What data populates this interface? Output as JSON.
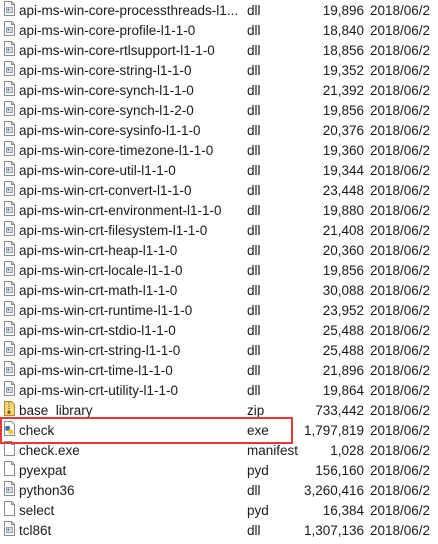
{
  "files": [
    {
      "name": "api-ms-win-core-processthreads-l1...",
      "type": "dll",
      "size": "19,896",
      "date": "2018/06/2",
      "icon": "dll-file-icon"
    },
    {
      "name": "api-ms-win-core-profile-l1-1-0",
      "type": "dll",
      "size": "18,840",
      "date": "2018/06/2",
      "icon": "dll-file-icon"
    },
    {
      "name": "api-ms-win-core-rtlsupport-l1-1-0",
      "type": "dll",
      "size": "18,856",
      "date": "2018/06/2",
      "icon": "dll-file-icon"
    },
    {
      "name": "api-ms-win-core-string-l1-1-0",
      "type": "dll",
      "size": "19,352",
      "date": "2018/06/2",
      "icon": "dll-file-icon"
    },
    {
      "name": "api-ms-win-core-synch-l1-1-0",
      "type": "dll",
      "size": "21,392",
      "date": "2018/06/2",
      "icon": "dll-file-icon"
    },
    {
      "name": "api-ms-win-core-synch-l1-2-0",
      "type": "dll",
      "size": "19,856",
      "date": "2018/06/2",
      "icon": "dll-file-icon"
    },
    {
      "name": "api-ms-win-core-sysinfo-l1-1-0",
      "type": "dll",
      "size": "20,376",
      "date": "2018/06/2",
      "icon": "dll-file-icon"
    },
    {
      "name": "api-ms-win-core-timezone-l1-1-0",
      "type": "dll",
      "size": "19,360",
      "date": "2018/06/2",
      "icon": "dll-file-icon"
    },
    {
      "name": "api-ms-win-core-util-l1-1-0",
      "type": "dll",
      "size": "19,344",
      "date": "2018/06/2",
      "icon": "dll-file-icon"
    },
    {
      "name": "api-ms-win-crt-convert-l1-1-0",
      "type": "dll",
      "size": "23,448",
      "date": "2018/06/2",
      "icon": "dll-file-icon"
    },
    {
      "name": "api-ms-win-crt-environment-l1-1-0",
      "type": "dll",
      "size": "19,880",
      "date": "2018/06/2",
      "icon": "dll-file-icon"
    },
    {
      "name": "api-ms-win-crt-filesystem-l1-1-0",
      "type": "dll",
      "size": "21,408",
      "date": "2018/06/2",
      "icon": "dll-file-icon"
    },
    {
      "name": "api-ms-win-crt-heap-l1-1-0",
      "type": "dll",
      "size": "20,360",
      "date": "2018/06/2",
      "icon": "dll-file-icon"
    },
    {
      "name": "api-ms-win-crt-locale-l1-1-0",
      "type": "dll",
      "size": "19,856",
      "date": "2018/06/2",
      "icon": "dll-file-icon"
    },
    {
      "name": "api-ms-win-crt-math-l1-1-0",
      "type": "dll",
      "size": "30,088",
      "date": "2018/06/2",
      "icon": "dll-file-icon"
    },
    {
      "name": "api-ms-win-crt-runtime-l1-1-0",
      "type": "dll",
      "size": "23,952",
      "date": "2018/06/2",
      "icon": "dll-file-icon"
    },
    {
      "name": "api-ms-win-crt-stdio-l1-1-0",
      "type": "dll",
      "size": "25,488",
      "date": "2018/06/2",
      "icon": "dll-file-icon"
    },
    {
      "name": "api-ms-win-crt-string-l1-1-0",
      "type": "dll",
      "size": "25,488",
      "date": "2018/06/2",
      "icon": "dll-file-icon"
    },
    {
      "name": "api-ms-win-crt-time-l1-1-0",
      "type": "dll",
      "size": "21,896",
      "date": "2018/06/2",
      "icon": "dll-file-icon"
    },
    {
      "name": "api-ms-win-crt-utility-l1-1-0",
      "type": "dll",
      "size": "19,864",
      "date": "2018/06/2",
      "icon": "dll-file-icon"
    },
    {
      "name": "base_library",
      "type": "zip",
      "size": "733,442",
      "date": "2018/06/2",
      "icon": "zip-archive-icon"
    },
    {
      "name": "check",
      "type": "exe",
      "size": "1,797,819",
      "date": "2018/06/2",
      "icon": "python-exe-icon"
    },
    {
      "name": "check.exe",
      "type": "manifest",
      "size": "1,028",
      "date": "2018/06/2",
      "icon": "document-file-icon"
    },
    {
      "name": "pyexpat",
      "type": "pyd",
      "size": "156,160",
      "date": "2018/06/2",
      "icon": "document-file-icon"
    },
    {
      "name": "python36",
      "type": "dll",
      "size": "3,260,416",
      "date": "2018/06/2",
      "icon": "dll-file-icon"
    },
    {
      "name": "select",
      "type": "pyd",
      "size": "16,384",
      "date": "2018/06/2",
      "icon": "document-file-icon"
    },
    {
      "name": "tcl86t",
      "type": "dll",
      "size": "1,307,136",
      "date": "2018/06/2",
      "icon": "dll-file-icon"
    }
  ],
  "colors": {
    "highlight_border": "#e53935",
    "text": "#1a1a1a"
  }
}
